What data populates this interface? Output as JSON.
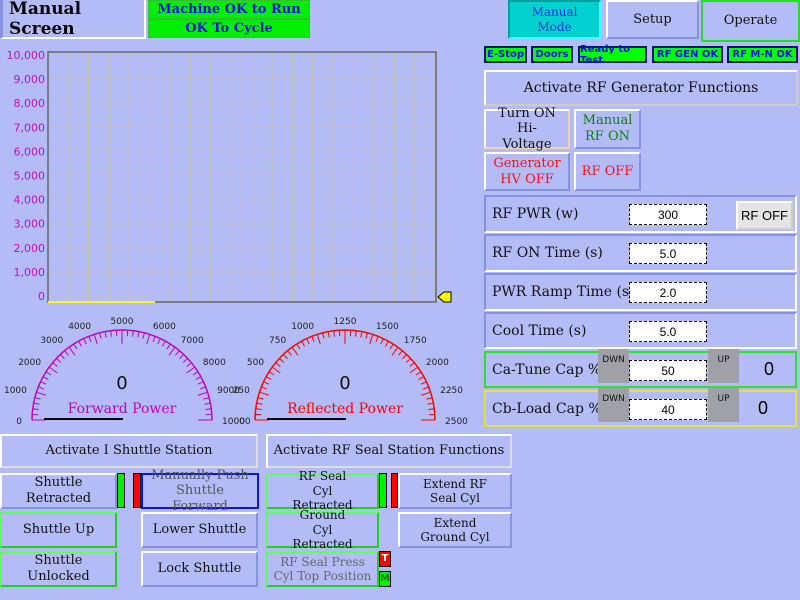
{
  "header": {
    "title": "Manual Screen",
    "status1": "Machine OK to Run",
    "status2": "OK To Cycle"
  },
  "nav": {
    "manual_mode": "Manual Mode",
    "setup": "Setup",
    "operate": "Operate"
  },
  "badges": [
    "E-Stop",
    "Doors",
    "Ready to Test",
    "RF GEN OK",
    "RF M-N OK"
  ],
  "rf_gen": {
    "title": "Activate RF Generator Functions",
    "turn_on_hv": "Turn ON Hi-Voltage",
    "manual_rf_on": "Manual RF ON",
    "gen_hv_off": "Generator HV OFF",
    "rf_off": "RF OFF"
  },
  "params": {
    "rf_pwr": {
      "label": "RF PWR (w)",
      "value": "300",
      "button": "RF OFF"
    },
    "rf_on_time": {
      "label": "RF ON Time (s)",
      "value": "5.0"
    },
    "ramp_time": {
      "label": "PWR Ramp Time (s)",
      "value": "2.0"
    },
    "cool_time": {
      "label": "Cool Time (s)",
      "value": "5.0"
    },
    "ca_tune": {
      "label": "Ca-Tune Cap %",
      "value": "50",
      "down": "DWN",
      "up": "UP",
      "readout": "0"
    },
    "cb_load": {
      "label": "Cb-Load Cap %",
      "value": "40",
      "down": "DWN",
      "up": "UP",
      "readout": "0"
    }
  },
  "chart_data": {
    "type": "line",
    "ylim": [
      0,
      10000
    ],
    "yticks": [
      "0",
      "1,000",
      "2,000",
      "3,000",
      "4,000",
      "5,000",
      "6,000",
      "7,000",
      "8,000",
      "9,000",
      "10,000"
    ],
    "grid": true,
    "series": []
  },
  "gauges": {
    "forward": {
      "label": "Forward Power",
      "value": "0",
      "min": 0,
      "max": 10000,
      "ticks": [
        "0",
        "1000",
        "2000",
        "3000",
        "4000",
        "5000",
        "6000",
        "7000",
        "8000",
        "9000",
        "10000"
      ],
      "color": "#c000c0"
    },
    "reflected": {
      "label": "Reflected Power",
      "value": "0",
      "min": 0,
      "max": 2500,
      "ticks": [
        "0",
        "250",
        "500",
        "750",
        "1000",
        "1250",
        "1500",
        "1750",
        "2000",
        "2250",
        "2500"
      ],
      "color": "#ff0000"
    }
  },
  "shuttle": {
    "title": "Activate I Shuttle Station",
    "retracted": "Shuttle Retracted",
    "push_forward": "Manually Push Shuttle Forward",
    "up": "Shuttle Up",
    "lower": "Lower Shuttle",
    "unlocked": "Shuttle Unlocked",
    "lock": "Lock Shuttle"
  },
  "seal": {
    "title": "Activate RF Seal Station Functions",
    "cyl_retracted": "RF Seal Cyl Retracted",
    "extend_cyl": "Extend RF Seal Cyl",
    "ground_retracted": "Ground Cyl Retracted",
    "extend_ground": "Extend Ground Cyl",
    "press_top": "RF Seal Press Cyl Top Position",
    "t": "T",
    "m": "M"
  }
}
